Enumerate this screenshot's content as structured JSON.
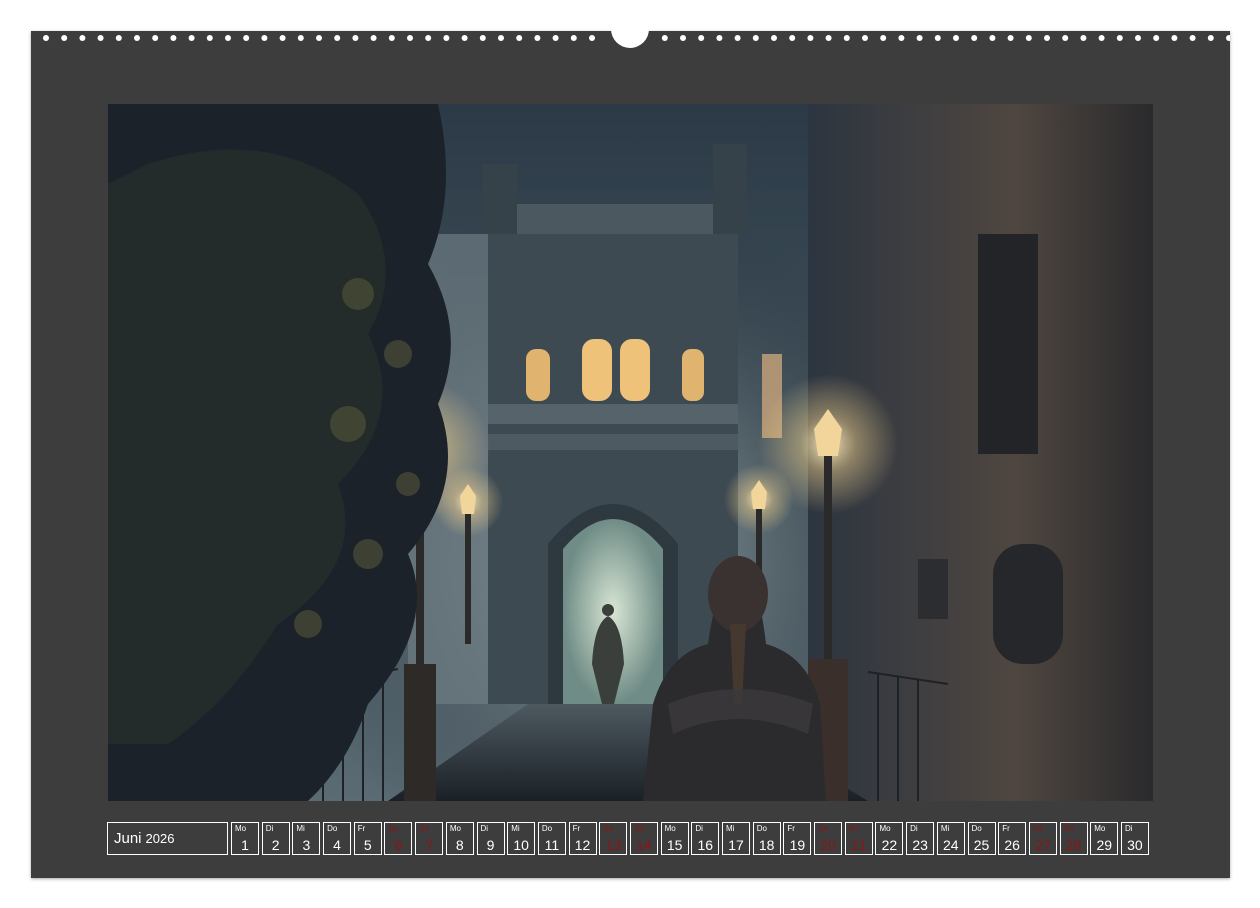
{
  "calendar": {
    "month": "Juni",
    "year": "2026",
    "days": [
      {
        "wd": "Mo",
        "num": "1",
        "weekend": false
      },
      {
        "wd": "Di",
        "num": "2",
        "weekend": false
      },
      {
        "wd": "Mi",
        "num": "3",
        "weekend": false
      },
      {
        "wd": "Do",
        "num": "4",
        "weekend": false
      },
      {
        "wd": "Fr",
        "num": "5",
        "weekend": false
      },
      {
        "wd": "Sa",
        "num": "6",
        "weekend": true
      },
      {
        "wd": "So",
        "num": "7",
        "weekend": true
      },
      {
        "wd": "Mo",
        "num": "8",
        "weekend": false
      },
      {
        "wd": "Di",
        "num": "9",
        "weekend": false
      },
      {
        "wd": "Mi",
        "num": "10",
        "weekend": false
      },
      {
        "wd": "Do",
        "num": "11",
        "weekend": false
      },
      {
        "wd": "Fr",
        "num": "12",
        "weekend": false
      },
      {
        "wd": "Sa",
        "num": "13",
        "weekend": true
      },
      {
        "wd": "So",
        "num": "14",
        "weekend": true
      },
      {
        "wd": "Mo",
        "num": "15",
        "weekend": false
      },
      {
        "wd": "Di",
        "num": "16",
        "weekend": false
      },
      {
        "wd": "Mi",
        "num": "17",
        "weekend": false
      },
      {
        "wd": "Do",
        "num": "18",
        "weekend": false
      },
      {
        "wd": "Fr",
        "num": "19",
        "weekend": false
      },
      {
        "wd": "Sa",
        "num": "20",
        "weekend": true
      },
      {
        "wd": "So",
        "num": "21",
        "weekend": true
      },
      {
        "wd": "Mo",
        "num": "22",
        "weekend": false
      },
      {
        "wd": "Di",
        "num": "23",
        "weekend": false
      },
      {
        "wd": "Mi",
        "num": "24",
        "weekend": false
      },
      {
        "wd": "Do",
        "num": "25",
        "weekend": false
      },
      {
        "wd": "Fr",
        "num": "26",
        "weekend": false
      },
      {
        "wd": "Sa",
        "num": "27",
        "weekend": true
      },
      {
        "wd": "So",
        "num": "28",
        "weekend": true
      },
      {
        "wd": "Mo",
        "num": "29",
        "weekend": false
      },
      {
        "wd": "Di",
        "num": "30",
        "weekend": false
      }
    ]
  },
  "colors": {
    "sheet": "#3d3d3d",
    "text": "#ffffff",
    "weekend": "#8e1414"
  }
}
